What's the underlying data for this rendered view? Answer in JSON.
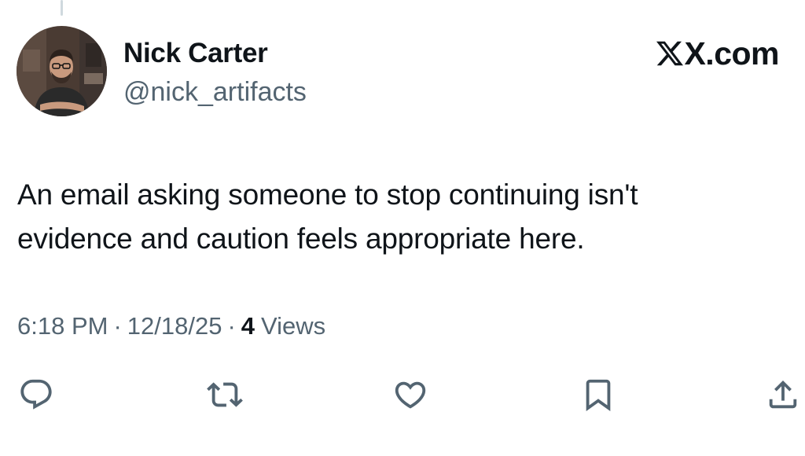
{
  "author": {
    "display_name": "Nick Carter",
    "handle": "@nick_artifacts"
  },
  "brand": {
    "label": "X.com",
    "icon": "x-logo-icon"
  },
  "tweet": {
    "text": "An email asking someone to stop continuing isn't\nevidence and caution feels appropriate here."
  },
  "meta": {
    "time": "6:18 PM",
    "separator": "·",
    "date": "12/18/25",
    "views_count": "4",
    "views_label": "Views"
  },
  "actions": [
    {
      "name": "reply",
      "icon": "reply-icon"
    },
    {
      "name": "repost",
      "icon": "repost-icon"
    },
    {
      "name": "like",
      "icon": "heart-icon"
    },
    {
      "name": "bookmark",
      "icon": "bookmark-icon"
    },
    {
      "name": "share",
      "icon": "share-icon"
    }
  ],
  "colors": {
    "text_primary": "#0f1419",
    "text_secondary": "#536471",
    "icon": "#536471",
    "thread_line": "#cfd9de"
  }
}
